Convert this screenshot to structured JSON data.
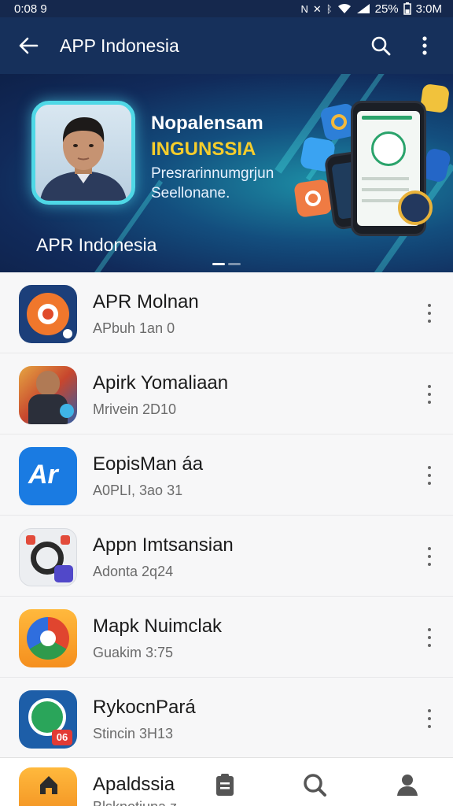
{
  "status_bar": {
    "time": "0:08 9",
    "battery": "25%",
    "clock_right": "3:0M"
  },
  "app_bar": {
    "title": "APP Indonesia"
  },
  "banner": {
    "headline": "Nopalensam",
    "sub_headline": "INGUNSSIA",
    "description": "Presrarinnumgrjun Seellonane.",
    "caption": "APR Indonesia"
  },
  "apps": [
    {
      "name": "APR Molnan",
      "meta": "APbuh 1an 0"
    },
    {
      "name": "Apirk Yomaliaan",
      "meta": "Mrivein 2D10"
    },
    {
      "name": "EopisMan áa",
      "meta": "A0PLI, 3ao 31"
    },
    {
      "name": "Appn Imtsansian",
      "meta": "Adonta 2q24"
    },
    {
      "name": "Mapk Nuimclak",
      "meta": "Guakim 3:75"
    },
    {
      "name": "RykocnPará",
      "meta": "Stincin 3H13"
    }
  ],
  "bottom_nav": {
    "partial_item_name": "Apaldssia",
    "partial_item_meta": "Blsknotiuna z",
    "items": [
      "home-icon",
      "clipboard-icon",
      "search-icon",
      "profile-icon"
    ]
  },
  "colors": {
    "app_bar": "#16305b",
    "banner_accent": "#4fd8e6",
    "highlight_yellow": "#f5cd2c"
  },
  "icons": {
    "icon_ar_text": "Ar",
    "icon_badge_text": "06"
  }
}
